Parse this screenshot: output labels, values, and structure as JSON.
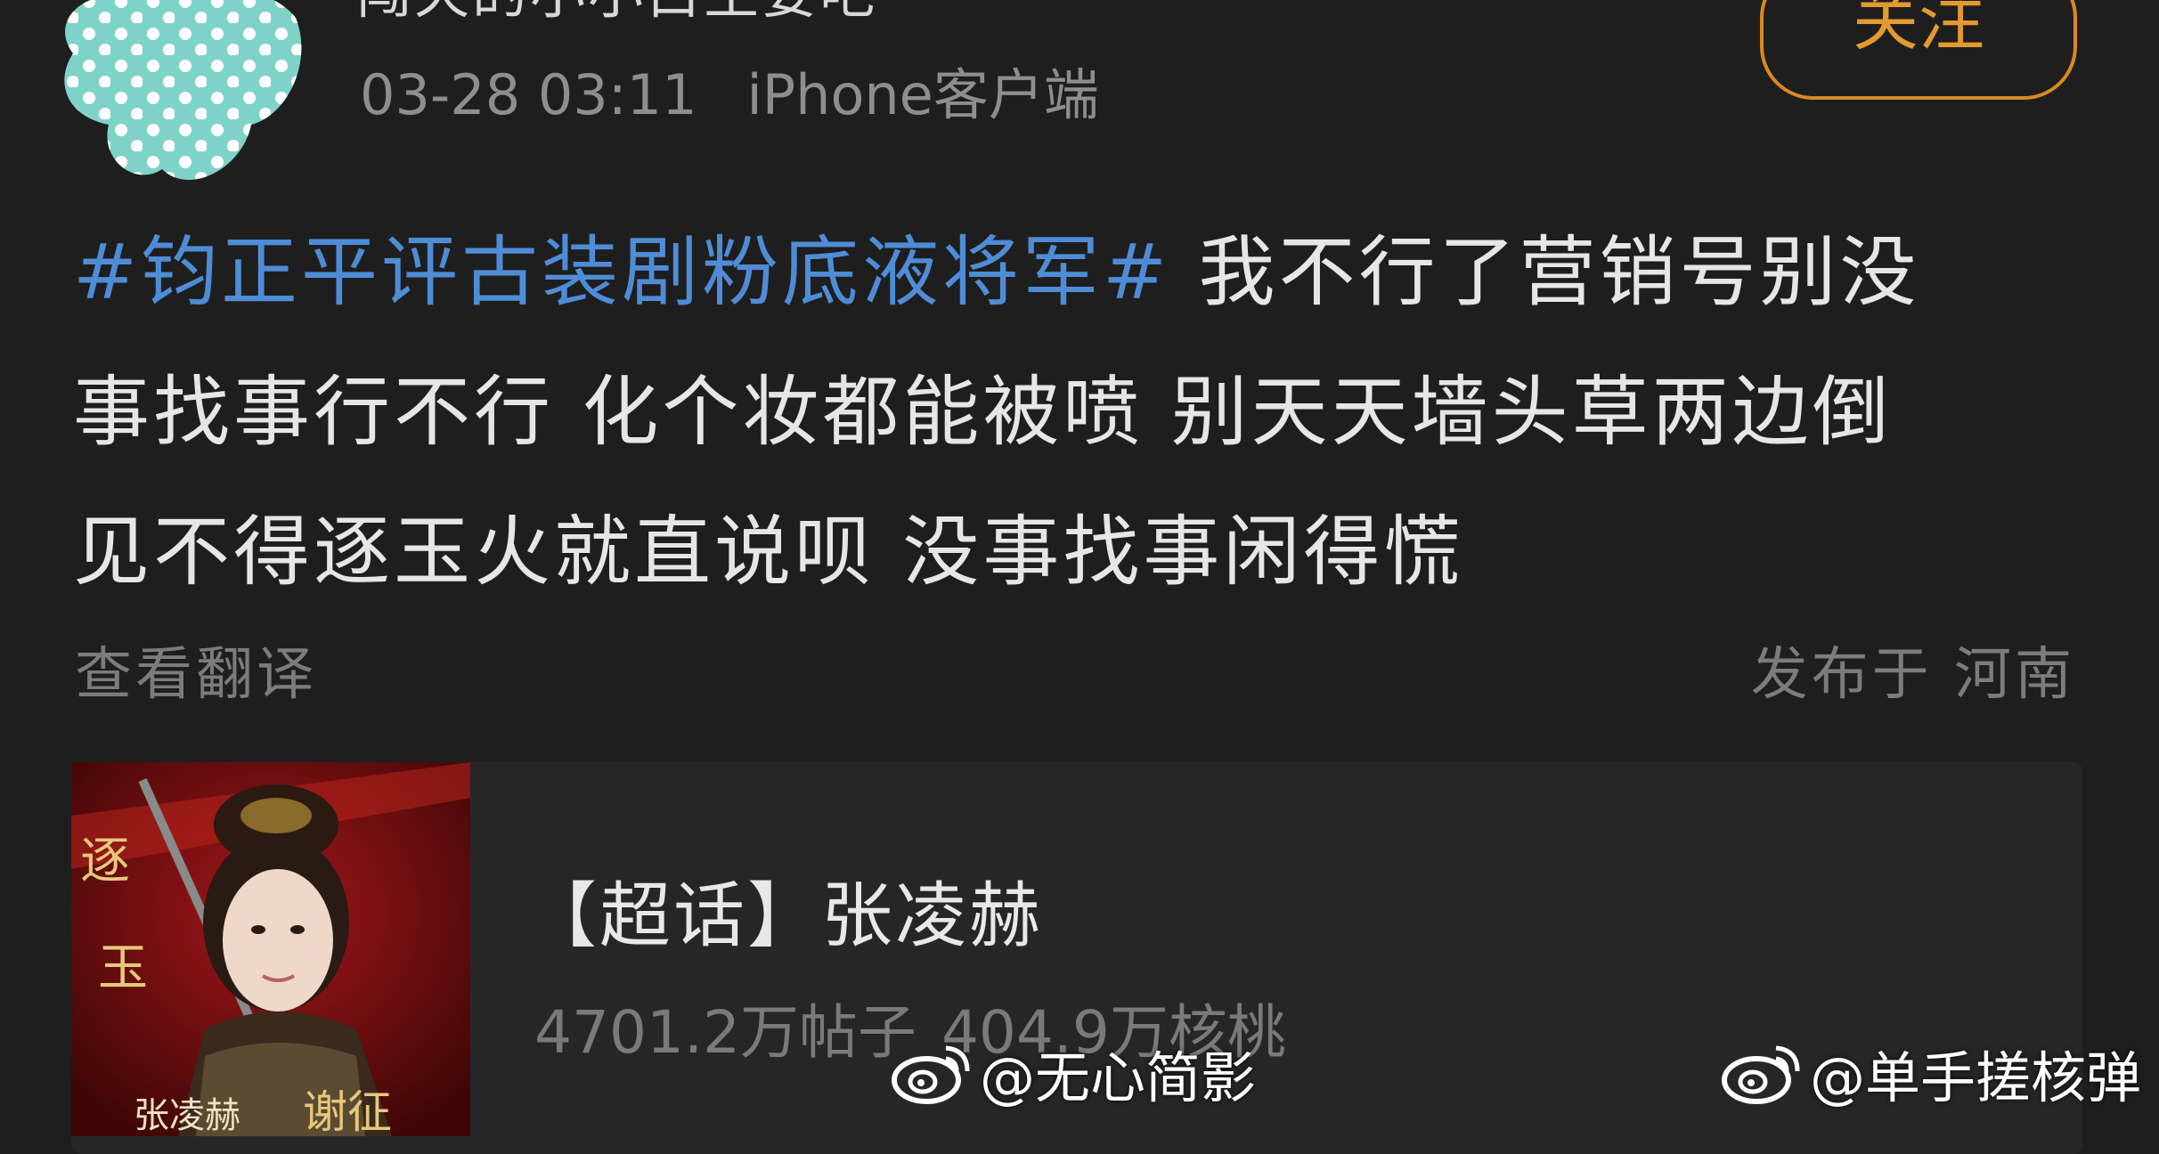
{
  "header": {
    "username_fragment": "闯天的小小白主要吧",
    "timestamp": "03-28 03:11",
    "client": "iPhone客户端",
    "follow_label": "关注"
  },
  "post": {
    "hashtag": "#钧正平评古装剧粉底液将军#",
    "line1_text": "我不行了营销号别没",
    "line2": "事找事行不行 化个妆都能被喷 别天天墙头草两边倒",
    "line3": "见不得逐玉火就直说呗 没事找事闲得慌",
    "translate_label": "查看翻译",
    "location": "发布于 河南"
  },
  "supertopic": {
    "title": "【超话】张凌赫",
    "posts_count": "4701.2万帖子",
    "walnut_count": "404.9万核桃",
    "poster_text_1": "逐",
    "poster_text_2": "玉",
    "poster_name": "张凌赫",
    "poster_role": "谢征"
  },
  "watermarks": {
    "left": "@无心简影",
    "right": "@单手搓核弹"
  },
  "colors": {
    "background": "#1e1e1f",
    "hashtag": "#4f8cd6",
    "follow_accent": "#d98a20",
    "muted_text": "#7c7c7c"
  },
  "icons": {
    "weibo_logo": "weibo-icon",
    "avatar": "avatar-image"
  }
}
